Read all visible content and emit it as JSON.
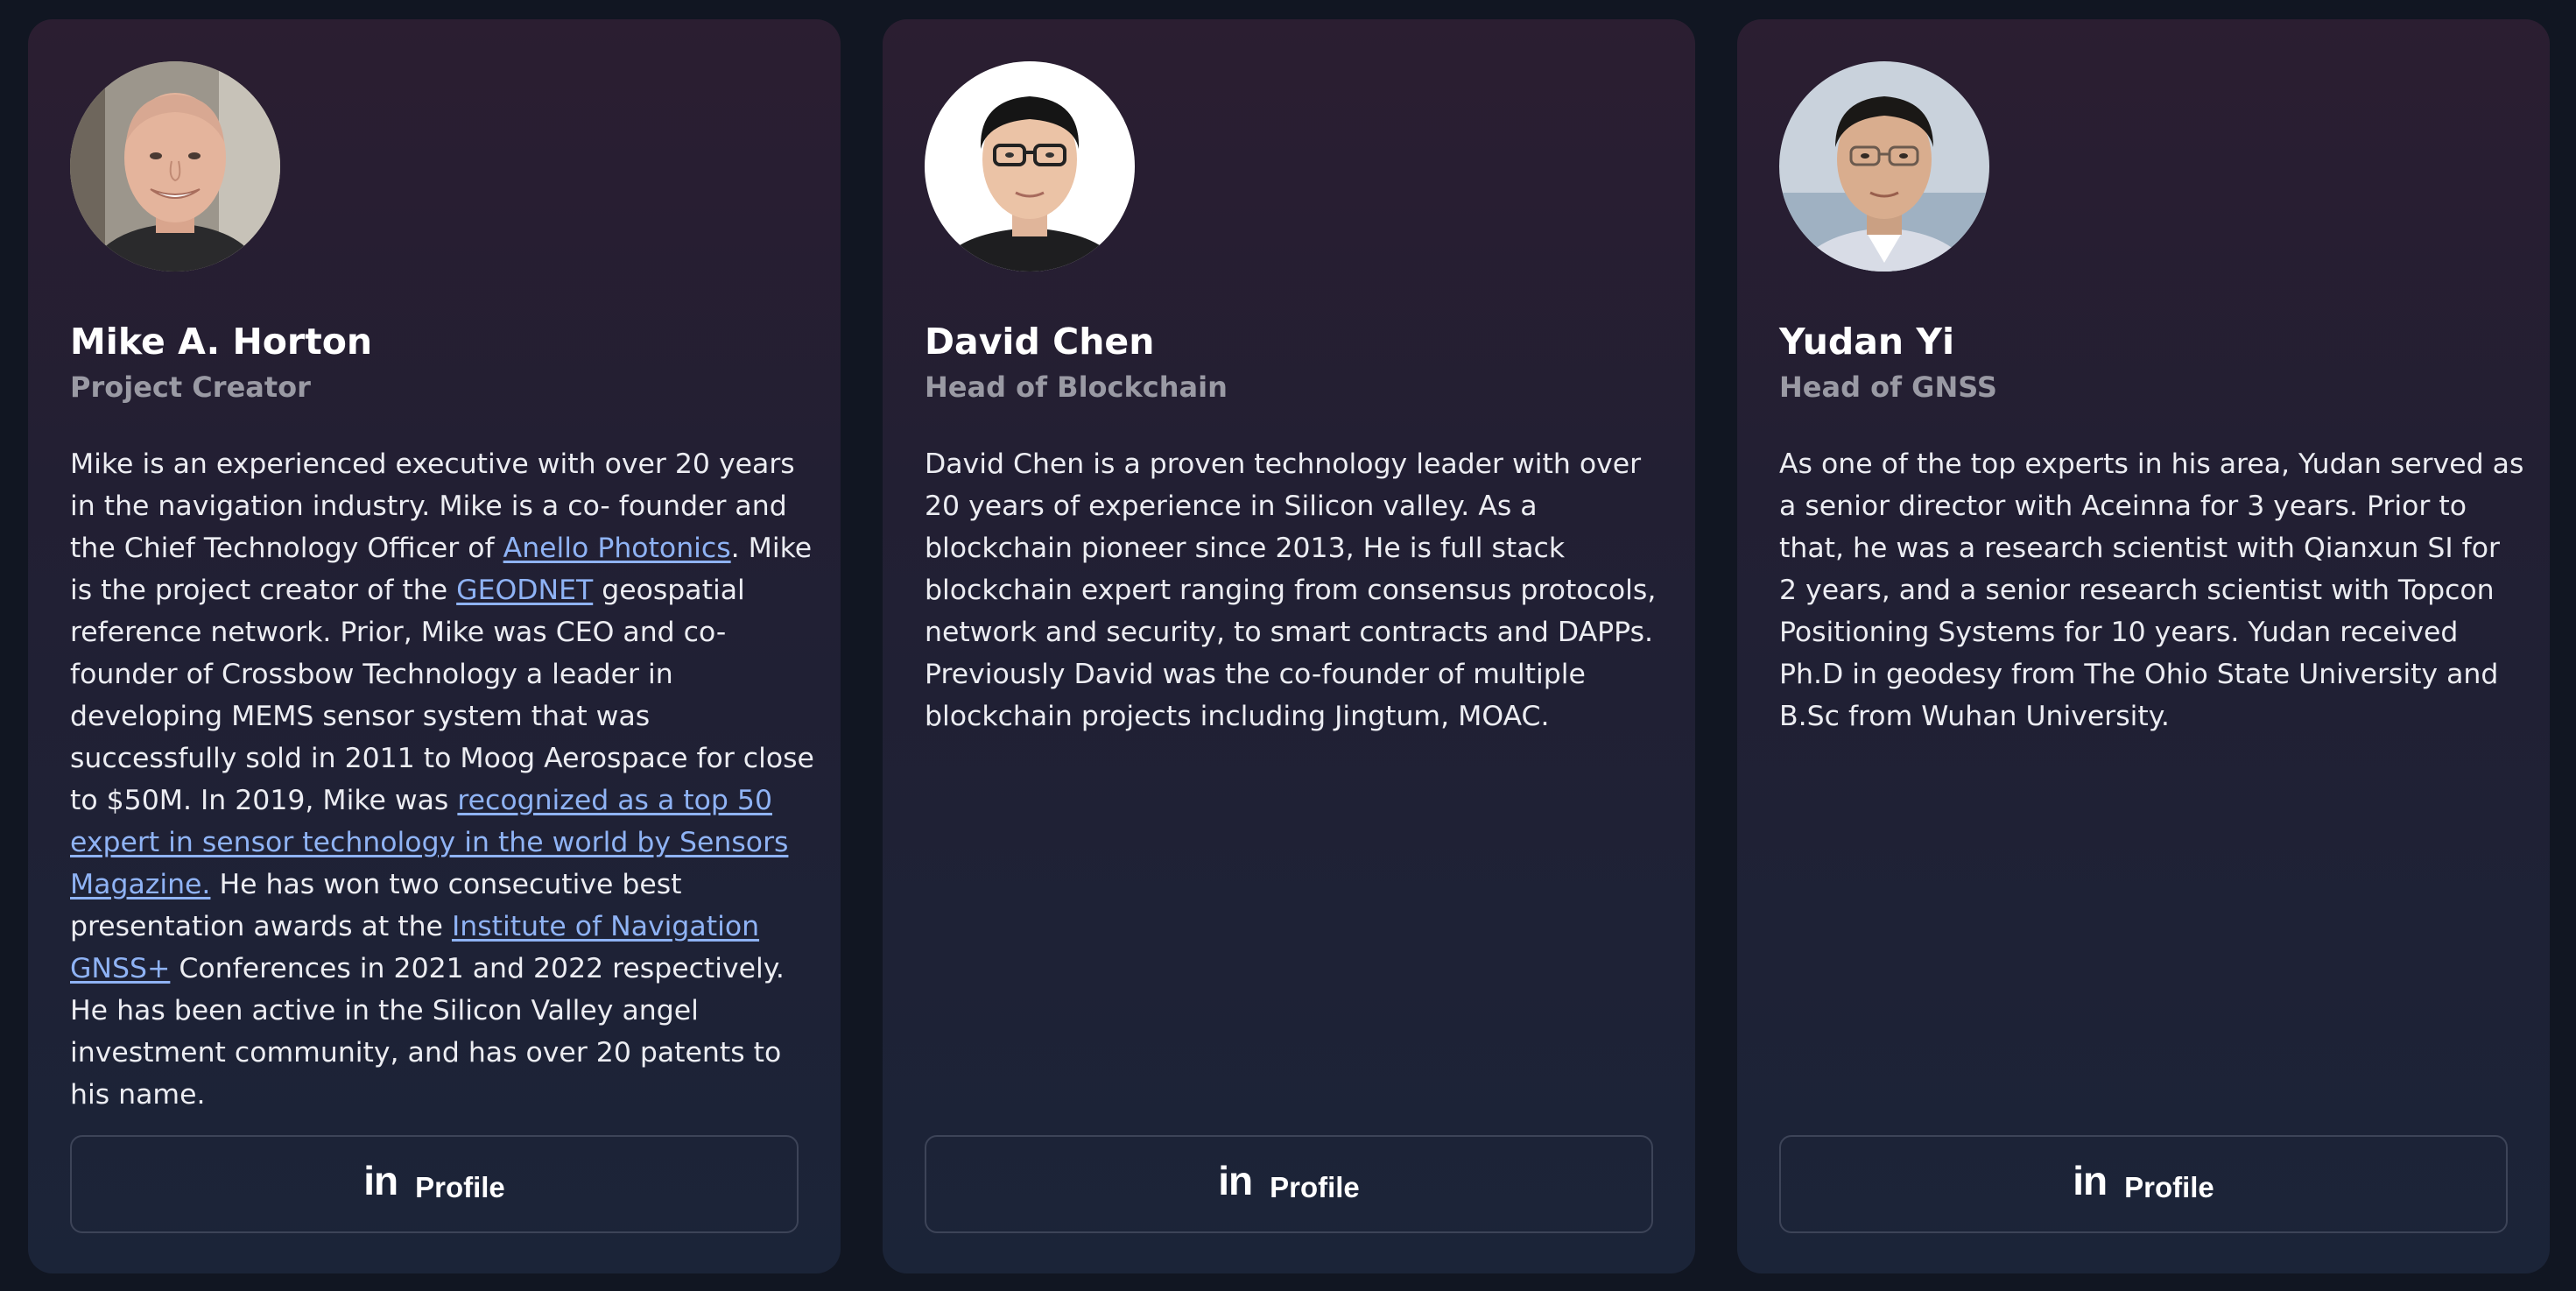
{
  "members": [
    {
      "name": "Mike A. Horton",
      "role": "Project Creator",
      "bio": [
        {
          "text": "Mike is an experienced executive with over 20 years in the navigation industry. Mike is a co- founder and the Chief Technology Officer of "
        },
        {
          "text": "Anello Photonics",
          "link": true
        },
        {
          "text": ". Mike is the project creator of the "
        },
        {
          "text": "GEODNET",
          "link": true
        },
        {
          "text": " geospatial reference network. Prior, Mike was CEO and co-founder of Crossbow Technology a leader in developing MEMS sensor system that was successfully sold in 2011 to Moog Aerospace for close to $50M. In 2019, Mike was "
        },
        {
          "text": "recognized as a top 50 expert in sensor technology in the world by Sensors Magazine.",
          "link": true
        },
        {
          "text": " He has won two consecutive best presentation awards at the "
        },
        {
          "text": "Institute of Navigation GNSS+",
          "link": true
        },
        {
          "text": " Conferences in 2021 and 2022 respectively. He has been active in the Silicon Valley angel investment community, and has over 20 patents to his name."
        }
      ],
      "profile_icon": "in",
      "profile_label": "Profile"
    },
    {
      "name": "David Chen",
      "role": "Head of Blockchain",
      "bio": [
        {
          "text": "David Chen is a proven technology leader with over 20 years of experience in Silicon valley. As a blockchain pioneer since 2013, He is full stack blockchain expert ranging from consensus protocols, network and security, to smart contracts and DAPPs. Previously David was the co-founder of multiple blockchain projects including Jingtum, MOAC."
        }
      ],
      "profile_icon": "in",
      "profile_label": "Profile"
    },
    {
      "name": "Yudan Yi",
      "role": "Head of GNSS",
      "bio": [
        {
          "text": "As one of the top experts in his area, Yudan served as a senior director with Aceinna for 3 years. Prior to that, he was a research scientist with Qianxun SI for 2 years, and a senior research scientist with Topcon Positioning Systems for 10 years. Yudan received Ph.D in geodesy from The Ohio State University and B.Sc from Wuhan University."
        }
      ],
      "profile_icon": "in",
      "profile_label": "Profile"
    }
  ],
  "colors": {
    "page_background": "#111622",
    "card_gradient_top": "#2b1e31",
    "card_gradient_bottom": "#1b2438",
    "name": "#ffffff",
    "role": "#9a9aa4",
    "bio_text": "#ecedf2",
    "link": "#8fb3f5",
    "button_border": "#3d4458"
  },
  "icons": [
    "linkedin-icon"
  ]
}
